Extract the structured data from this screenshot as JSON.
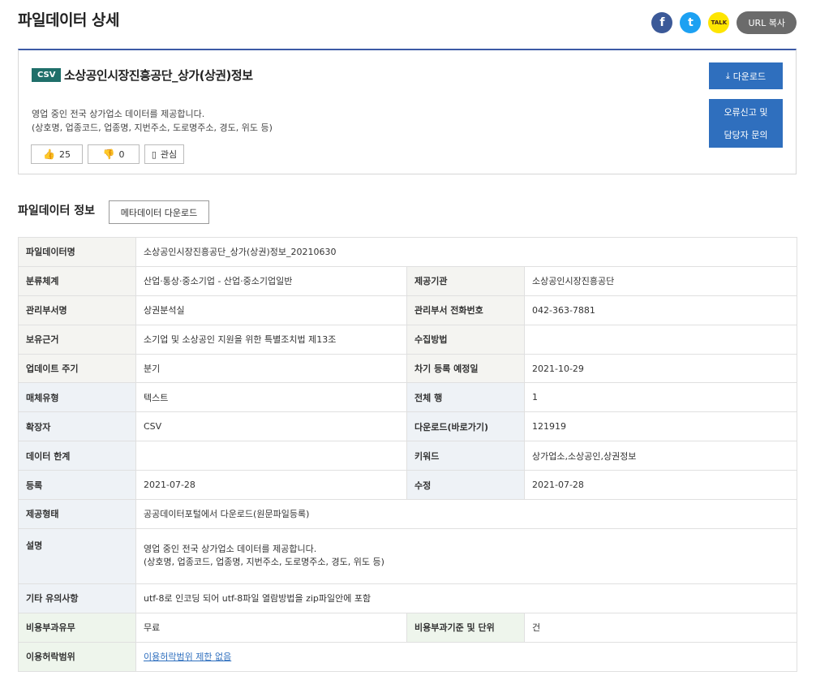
{
  "page": {
    "title": "파일데이터 상세"
  },
  "share": {
    "facebook": "f",
    "twitter": "t",
    "kakao": "TALK",
    "url_copy": "URL 복사"
  },
  "summary": {
    "format_badge": "CSV",
    "title": "소상공인시장진흥공단_상가(상권)정보",
    "desc_line1": "영업 중인 전국 상가업소 데이터를 제공합니다.",
    "desc_line2": "(상호명, 업종코드, 업종명, 지번주소, 도로명주소, 경도, 위도 등)",
    "likes": "25",
    "dislikes": "0",
    "favorite_label": "관심",
    "download_label": "다운로드",
    "report_line1": "오류신고 및",
    "report_line2": "담당자 문의"
  },
  "section": {
    "title": "파일데이터 정보",
    "meta_download": "메타데이터 다운로드"
  },
  "info": {
    "file_name_label": "파일데이터명",
    "file_name": "소상공인시장진흥공단_상가(상권)정보_20210630",
    "category_label": "분류체계",
    "category": "산업·통상·중소기업 - 산업·중소기업일반",
    "provider_label": "제공기관",
    "provider": "소상공인시장진흥공단",
    "dept_label": "관리부서명",
    "dept": "상권분석실",
    "phone_label": "관리부서 전화번호",
    "phone": "042-363-7881",
    "basis_label": "보유근거",
    "basis": "소기업 및 소상공인 지원을 위한 특별조치법 제13조",
    "collect_label": "수집방법",
    "collect": "",
    "cycle_label": "업데이트 주기",
    "cycle": "분기",
    "next_label": "차기 등록 예정일",
    "next": "2021-10-29",
    "media_label": "매체유형",
    "media": "텍스트",
    "rows_label": "전체 행",
    "rows": "1",
    "ext_label": "확장자",
    "ext": "CSV",
    "downloads_label": "다운로드(바로가기)",
    "downloads": "121919",
    "limit_label": "데이터 한계",
    "limit": "",
    "keywords_label": "키워드",
    "keywords": "상가업소,소상공인,상권정보",
    "reg_label": "등록",
    "reg": "2021-07-28",
    "mod_label": "수정",
    "mod": "2021-07-28",
    "provide_label": "제공형태",
    "provide": "공공데이터포털에서 다운로드(원문파일등록)",
    "desc_label": "설명",
    "desc_line1": "영업 중인 전국 상가업소 데이터를 제공합니다.",
    "desc_line2": "(상호명, 업종코드, 업종명, 지번주소, 도로명주소, 경도, 위도 등)",
    "notes_label": "기타 유의사항",
    "notes": "utf-8로 인코딩 되어 utf-8파일 열람방법을 zip파일안에 포함",
    "fee_label": "비용부과유무",
    "fee": "무료",
    "fee_basis_label": "비용부과기준 및 단위",
    "fee_basis": "건",
    "license_label": "이용허락범위",
    "license": "이용허락범위 제한 없음"
  },
  "colors": {
    "accent": "#2f6fbe",
    "badge": "#1f6f6a",
    "top_border": "#3c5aa6"
  }
}
